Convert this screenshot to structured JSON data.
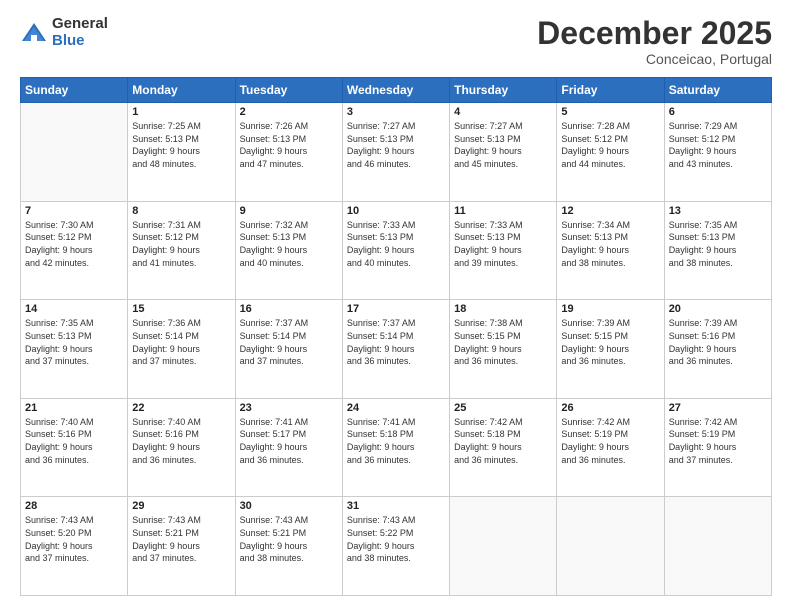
{
  "logo": {
    "general": "General",
    "blue": "Blue"
  },
  "header": {
    "month": "December 2025",
    "location": "Conceicao, Portugal"
  },
  "weekdays": [
    "Sunday",
    "Monday",
    "Tuesday",
    "Wednesday",
    "Thursday",
    "Friday",
    "Saturday"
  ],
  "weeks": [
    [
      {
        "day": "",
        "info": ""
      },
      {
        "day": "1",
        "info": "Sunrise: 7:25 AM\nSunset: 5:13 PM\nDaylight: 9 hours\nand 48 minutes."
      },
      {
        "day": "2",
        "info": "Sunrise: 7:26 AM\nSunset: 5:13 PM\nDaylight: 9 hours\nand 47 minutes."
      },
      {
        "day": "3",
        "info": "Sunrise: 7:27 AM\nSunset: 5:13 PM\nDaylight: 9 hours\nand 46 minutes."
      },
      {
        "day": "4",
        "info": "Sunrise: 7:27 AM\nSunset: 5:13 PM\nDaylight: 9 hours\nand 45 minutes."
      },
      {
        "day": "5",
        "info": "Sunrise: 7:28 AM\nSunset: 5:12 PM\nDaylight: 9 hours\nand 44 minutes."
      },
      {
        "day": "6",
        "info": "Sunrise: 7:29 AM\nSunset: 5:12 PM\nDaylight: 9 hours\nand 43 minutes."
      }
    ],
    [
      {
        "day": "7",
        "info": "Sunrise: 7:30 AM\nSunset: 5:12 PM\nDaylight: 9 hours\nand 42 minutes."
      },
      {
        "day": "8",
        "info": "Sunrise: 7:31 AM\nSunset: 5:12 PM\nDaylight: 9 hours\nand 41 minutes."
      },
      {
        "day": "9",
        "info": "Sunrise: 7:32 AM\nSunset: 5:13 PM\nDaylight: 9 hours\nand 40 minutes."
      },
      {
        "day": "10",
        "info": "Sunrise: 7:33 AM\nSunset: 5:13 PM\nDaylight: 9 hours\nand 40 minutes."
      },
      {
        "day": "11",
        "info": "Sunrise: 7:33 AM\nSunset: 5:13 PM\nDaylight: 9 hours\nand 39 minutes."
      },
      {
        "day": "12",
        "info": "Sunrise: 7:34 AM\nSunset: 5:13 PM\nDaylight: 9 hours\nand 38 minutes."
      },
      {
        "day": "13",
        "info": "Sunrise: 7:35 AM\nSunset: 5:13 PM\nDaylight: 9 hours\nand 38 minutes."
      }
    ],
    [
      {
        "day": "14",
        "info": "Sunrise: 7:35 AM\nSunset: 5:13 PM\nDaylight: 9 hours\nand 37 minutes."
      },
      {
        "day": "15",
        "info": "Sunrise: 7:36 AM\nSunset: 5:14 PM\nDaylight: 9 hours\nand 37 minutes."
      },
      {
        "day": "16",
        "info": "Sunrise: 7:37 AM\nSunset: 5:14 PM\nDaylight: 9 hours\nand 37 minutes."
      },
      {
        "day": "17",
        "info": "Sunrise: 7:37 AM\nSunset: 5:14 PM\nDaylight: 9 hours\nand 36 minutes."
      },
      {
        "day": "18",
        "info": "Sunrise: 7:38 AM\nSunset: 5:15 PM\nDaylight: 9 hours\nand 36 minutes."
      },
      {
        "day": "19",
        "info": "Sunrise: 7:39 AM\nSunset: 5:15 PM\nDaylight: 9 hours\nand 36 minutes."
      },
      {
        "day": "20",
        "info": "Sunrise: 7:39 AM\nSunset: 5:16 PM\nDaylight: 9 hours\nand 36 minutes."
      }
    ],
    [
      {
        "day": "21",
        "info": "Sunrise: 7:40 AM\nSunset: 5:16 PM\nDaylight: 9 hours\nand 36 minutes."
      },
      {
        "day": "22",
        "info": "Sunrise: 7:40 AM\nSunset: 5:16 PM\nDaylight: 9 hours\nand 36 minutes."
      },
      {
        "day": "23",
        "info": "Sunrise: 7:41 AM\nSunset: 5:17 PM\nDaylight: 9 hours\nand 36 minutes."
      },
      {
        "day": "24",
        "info": "Sunrise: 7:41 AM\nSunset: 5:18 PM\nDaylight: 9 hours\nand 36 minutes."
      },
      {
        "day": "25",
        "info": "Sunrise: 7:42 AM\nSunset: 5:18 PM\nDaylight: 9 hours\nand 36 minutes."
      },
      {
        "day": "26",
        "info": "Sunrise: 7:42 AM\nSunset: 5:19 PM\nDaylight: 9 hours\nand 36 minutes."
      },
      {
        "day": "27",
        "info": "Sunrise: 7:42 AM\nSunset: 5:19 PM\nDaylight: 9 hours\nand 37 minutes."
      }
    ],
    [
      {
        "day": "28",
        "info": "Sunrise: 7:43 AM\nSunset: 5:20 PM\nDaylight: 9 hours\nand 37 minutes."
      },
      {
        "day": "29",
        "info": "Sunrise: 7:43 AM\nSunset: 5:21 PM\nDaylight: 9 hours\nand 37 minutes."
      },
      {
        "day": "30",
        "info": "Sunrise: 7:43 AM\nSunset: 5:21 PM\nDaylight: 9 hours\nand 38 minutes."
      },
      {
        "day": "31",
        "info": "Sunrise: 7:43 AM\nSunset: 5:22 PM\nDaylight: 9 hours\nand 38 minutes."
      },
      {
        "day": "",
        "info": ""
      },
      {
        "day": "",
        "info": ""
      },
      {
        "day": "",
        "info": ""
      }
    ]
  ]
}
